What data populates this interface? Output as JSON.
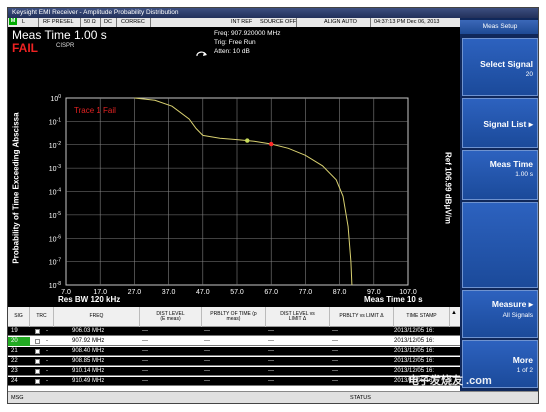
{
  "window": {
    "title": "Keysight EMI Receiver - Amplitude Probability Distribution"
  },
  "status_bar": {
    "mode_badge": "M",
    "items": [
      "L",
      "RF PRESEL",
      "50 Ω",
      "DC",
      "CORREC",
      "INT REF",
      "SOURCE OFF",
      "ALIGN AUTO",
      "04:37:13 PM Dec 06, 2013"
    ]
  },
  "header": {
    "meas_time": "Meas Time 1.00 s",
    "result": "FAIL",
    "standard": "CISPR",
    "freq": "Freq: 907.920000 MHz",
    "trig": "Trig: Free Run",
    "atten": "Atten: 10 dB"
  },
  "plot": {
    "y_axis_label": "Probability of Time Exceeding Abscissa",
    "ref_label": "Ref 106.99 dBμV/m",
    "trace_label": "Trace 1 Fail",
    "rbw": "Res BW  120 kHz",
    "meas_time": "Meas Time  10 s"
  },
  "chart_data": {
    "type": "line",
    "x_ticks": [
      "7.0",
      "17.0",
      "27.0",
      "37.0",
      "47.0",
      "57.0",
      "67.0",
      "77.0",
      "87.0",
      "97.0",
      "107.0"
    ],
    "y_ticks": [
      "10^0",
      "10^-1",
      "10^-2",
      "10^-3",
      "10^-4",
      "10^-5",
      "10^-6",
      "10^-7",
      "10^-8"
    ],
    "xlim": [
      7,
      107
    ],
    "ylim_exp": [
      -8,
      0
    ],
    "grid": true,
    "series": [
      {
        "color": "#d8d070",
        "points": [
          [
            27,
            0
          ],
          [
            33,
            -0.1
          ],
          [
            38,
            -0.35
          ],
          [
            43,
            -0.9
          ],
          [
            45,
            -1.3
          ],
          [
            47,
            -1.6
          ],
          [
            52,
            -1.72
          ],
          [
            57,
            -1.78
          ],
          [
            62,
            -1.85
          ],
          [
            67,
            -1.97
          ],
          [
            72,
            -2.15
          ],
          [
            77,
            -2.45
          ],
          [
            82,
            -2.9
          ],
          [
            86,
            -3.5
          ],
          [
            88,
            -4.2
          ],
          [
            89.5,
            -5.5
          ],
          [
            90.3,
            -7
          ],
          [
            90.6,
            -8
          ]
        ]
      }
    ],
    "markers": [
      {
        "x": 60,
        "y": -1.82,
        "color": "#c8dc5a"
      },
      {
        "x": 67,
        "y": -1.97,
        "color": "#ff2a2a"
      }
    ]
  },
  "table": {
    "headers": {
      "sig": "SIG",
      "trc": "TRC",
      "freq": "FREQ",
      "dist_level": "DIST LEVEL",
      "dist_level_sub": "(E meas)",
      "prblty": "PRBLTY OF TIME (p",
      "prblty_sub": "meas)",
      "dist_vs_limit": "DIST LEVEL vs",
      "dist_vs_limit_sub": "LIMIT Δ",
      "prblty_vs_limit": "PRBLTY vs LIMIT Δ",
      "time_stamp": "TIME STAMP"
    },
    "rows": [
      {
        "sig": "19",
        "trc": "1",
        "freq": "906.03 MHz",
        "dist": "---",
        "prob": "---",
        "dvl": "---",
        "pvl": "---",
        "ts": "2013/12/05 16:",
        "selected": false
      },
      {
        "sig": "20",
        "trc": "1",
        "freq": "907.92 MHz",
        "dist": "---",
        "prob": "---",
        "dvl": "---",
        "pvl": "---",
        "ts": "2013/12/05 16:",
        "selected": true
      },
      {
        "sig": "21",
        "trc": "1",
        "freq": "908.40 MHz",
        "dist": "---",
        "prob": "---",
        "dvl": "---",
        "pvl": "---",
        "ts": "2013/12/05 16:",
        "selected": false
      },
      {
        "sig": "22",
        "trc": "1",
        "freq": "908.85 MHz",
        "dist": "---",
        "prob": "---",
        "dvl": "---",
        "pvl": "---",
        "ts": "2013/12/05 16:",
        "selected": false
      },
      {
        "sig": "23",
        "trc": "1",
        "freq": "910.14 MHz",
        "dist": "---",
        "prob": "---",
        "dvl": "---",
        "pvl": "---",
        "ts": "2013/12/05 16:",
        "selected": false
      },
      {
        "sig": "24",
        "trc": "1",
        "freq": "910.49 MHz",
        "dist": "---",
        "prob": "---",
        "dvl": "---",
        "pvl": "---",
        "ts": "2013/12/05 16:",
        "selected": false
      }
    ]
  },
  "bottom": {
    "msg": "MSG",
    "status": "STATUS"
  },
  "softkeys": {
    "header": "Meas Setup",
    "items": [
      {
        "label": "Select Signal",
        "value": "20"
      },
      {
        "label": "Signal List ▸",
        "value": ""
      },
      {
        "label": "Meas Time",
        "value": "1.00 s"
      },
      {
        "label": "",
        "value": ""
      },
      {
        "label": "Measure ▸",
        "value": "All Signals"
      },
      {
        "label": "More",
        "value": "1 of 2"
      }
    ]
  },
  "watermark": "电子发烧友 .com",
  "colors": {
    "fail": "#e22222",
    "grid": "#808080",
    "softkey_bg": "#10285a"
  }
}
